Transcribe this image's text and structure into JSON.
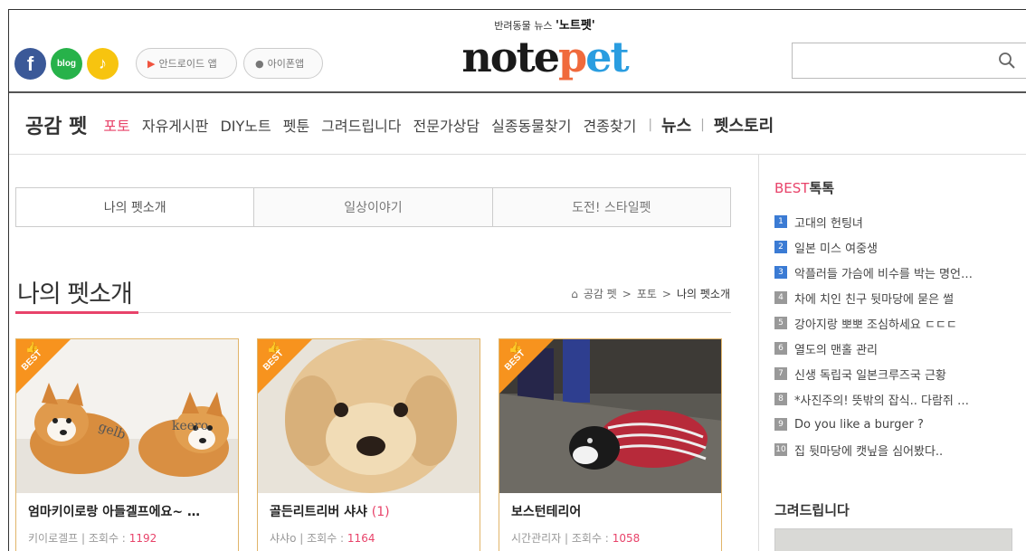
{
  "header": {
    "sns": [
      {
        "name": "facebook",
        "label": "f"
      },
      {
        "name": "blog",
        "label": "blog"
      },
      {
        "name": "kakao",
        "label": "♪"
      }
    ],
    "android_app": "안드로이드 앱",
    "iphone_app": "아이폰앱",
    "logo_sub_prefix": "반려동물 뉴스",
    "logo_sub_brand": "'노트펫'",
    "logo_text_a": "note",
    "logo_text_b": "p",
    "logo_text_c": "et",
    "search_placeholder": ""
  },
  "nav": {
    "brand": "공감 펫",
    "items": [
      {
        "label": "포토",
        "active": true
      },
      {
        "label": "자유게시판"
      },
      {
        "label": "DIY노트"
      },
      {
        "label": "펫툰"
      },
      {
        "label": "그려드립니다"
      },
      {
        "label": "전문가상담"
      },
      {
        "label": "실종동물찾기"
      },
      {
        "label": "견종찾기"
      }
    ],
    "news": "뉴스",
    "story": "펫스토리"
  },
  "tabs": [
    {
      "label": "나의 펫소개",
      "active": true
    },
    {
      "label": "일상이야기"
    },
    {
      "label": "도전! 스타일펫"
    }
  ],
  "section": {
    "title": "나의 펫소개",
    "breadcrumb": [
      "공감 펫",
      "포토",
      "나의 펫소개"
    ]
  },
  "cards": [
    {
      "badge": "BEST",
      "title": "엄마키이로랑 아들겔프에요~ …",
      "count": "",
      "author": "키이로겔프",
      "views_label": "조회수 :",
      "views": "1192"
    },
    {
      "badge": "BEST",
      "title": "골든리트리버 샤샤",
      "count": "(1)",
      "author": "샤샤o",
      "views_label": "조회수 :",
      "views": "1164"
    },
    {
      "badge": "BEST",
      "title": "보스턴테리어",
      "count": "",
      "author": "시간관리자",
      "views_label": "조회수 :",
      "views": "1058"
    }
  ],
  "sidebar": {
    "best_prefix": "BEST",
    "best_suffix": "톡톡",
    "best_items": [
      {
        "num": "1",
        "label": "고대의 헌팅녀"
      },
      {
        "num": "2",
        "label": "일본 미스 여중생"
      },
      {
        "num": "3",
        "label": "악플러들 가슴에 비수를 박는 명언…"
      },
      {
        "num": "4",
        "label": "차에 치인 친구 뒷마당에 묻은 썰"
      },
      {
        "num": "5",
        "label": "강아지랑 뽀뽀 조심하세요 ㄷㄷㄷ"
      },
      {
        "num": "6",
        "label": "열도의 맨홀 관리"
      },
      {
        "num": "7",
        "label": "신생 독립국 일본크루즈국 근황"
      },
      {
        "num": "8",
        "label": "*사진주의! 뜻밖의 잡식.. 다람쥐 …"
      },
      {
        "num": "9",
        "label": "Do you like a burger ?"
      },
      {
        "num": "10",
        "label": "집 뒷마당에 캣닢을 심어봤다.."
      }
    ],
    "draw_title": "그려드립니다"
  }
}
